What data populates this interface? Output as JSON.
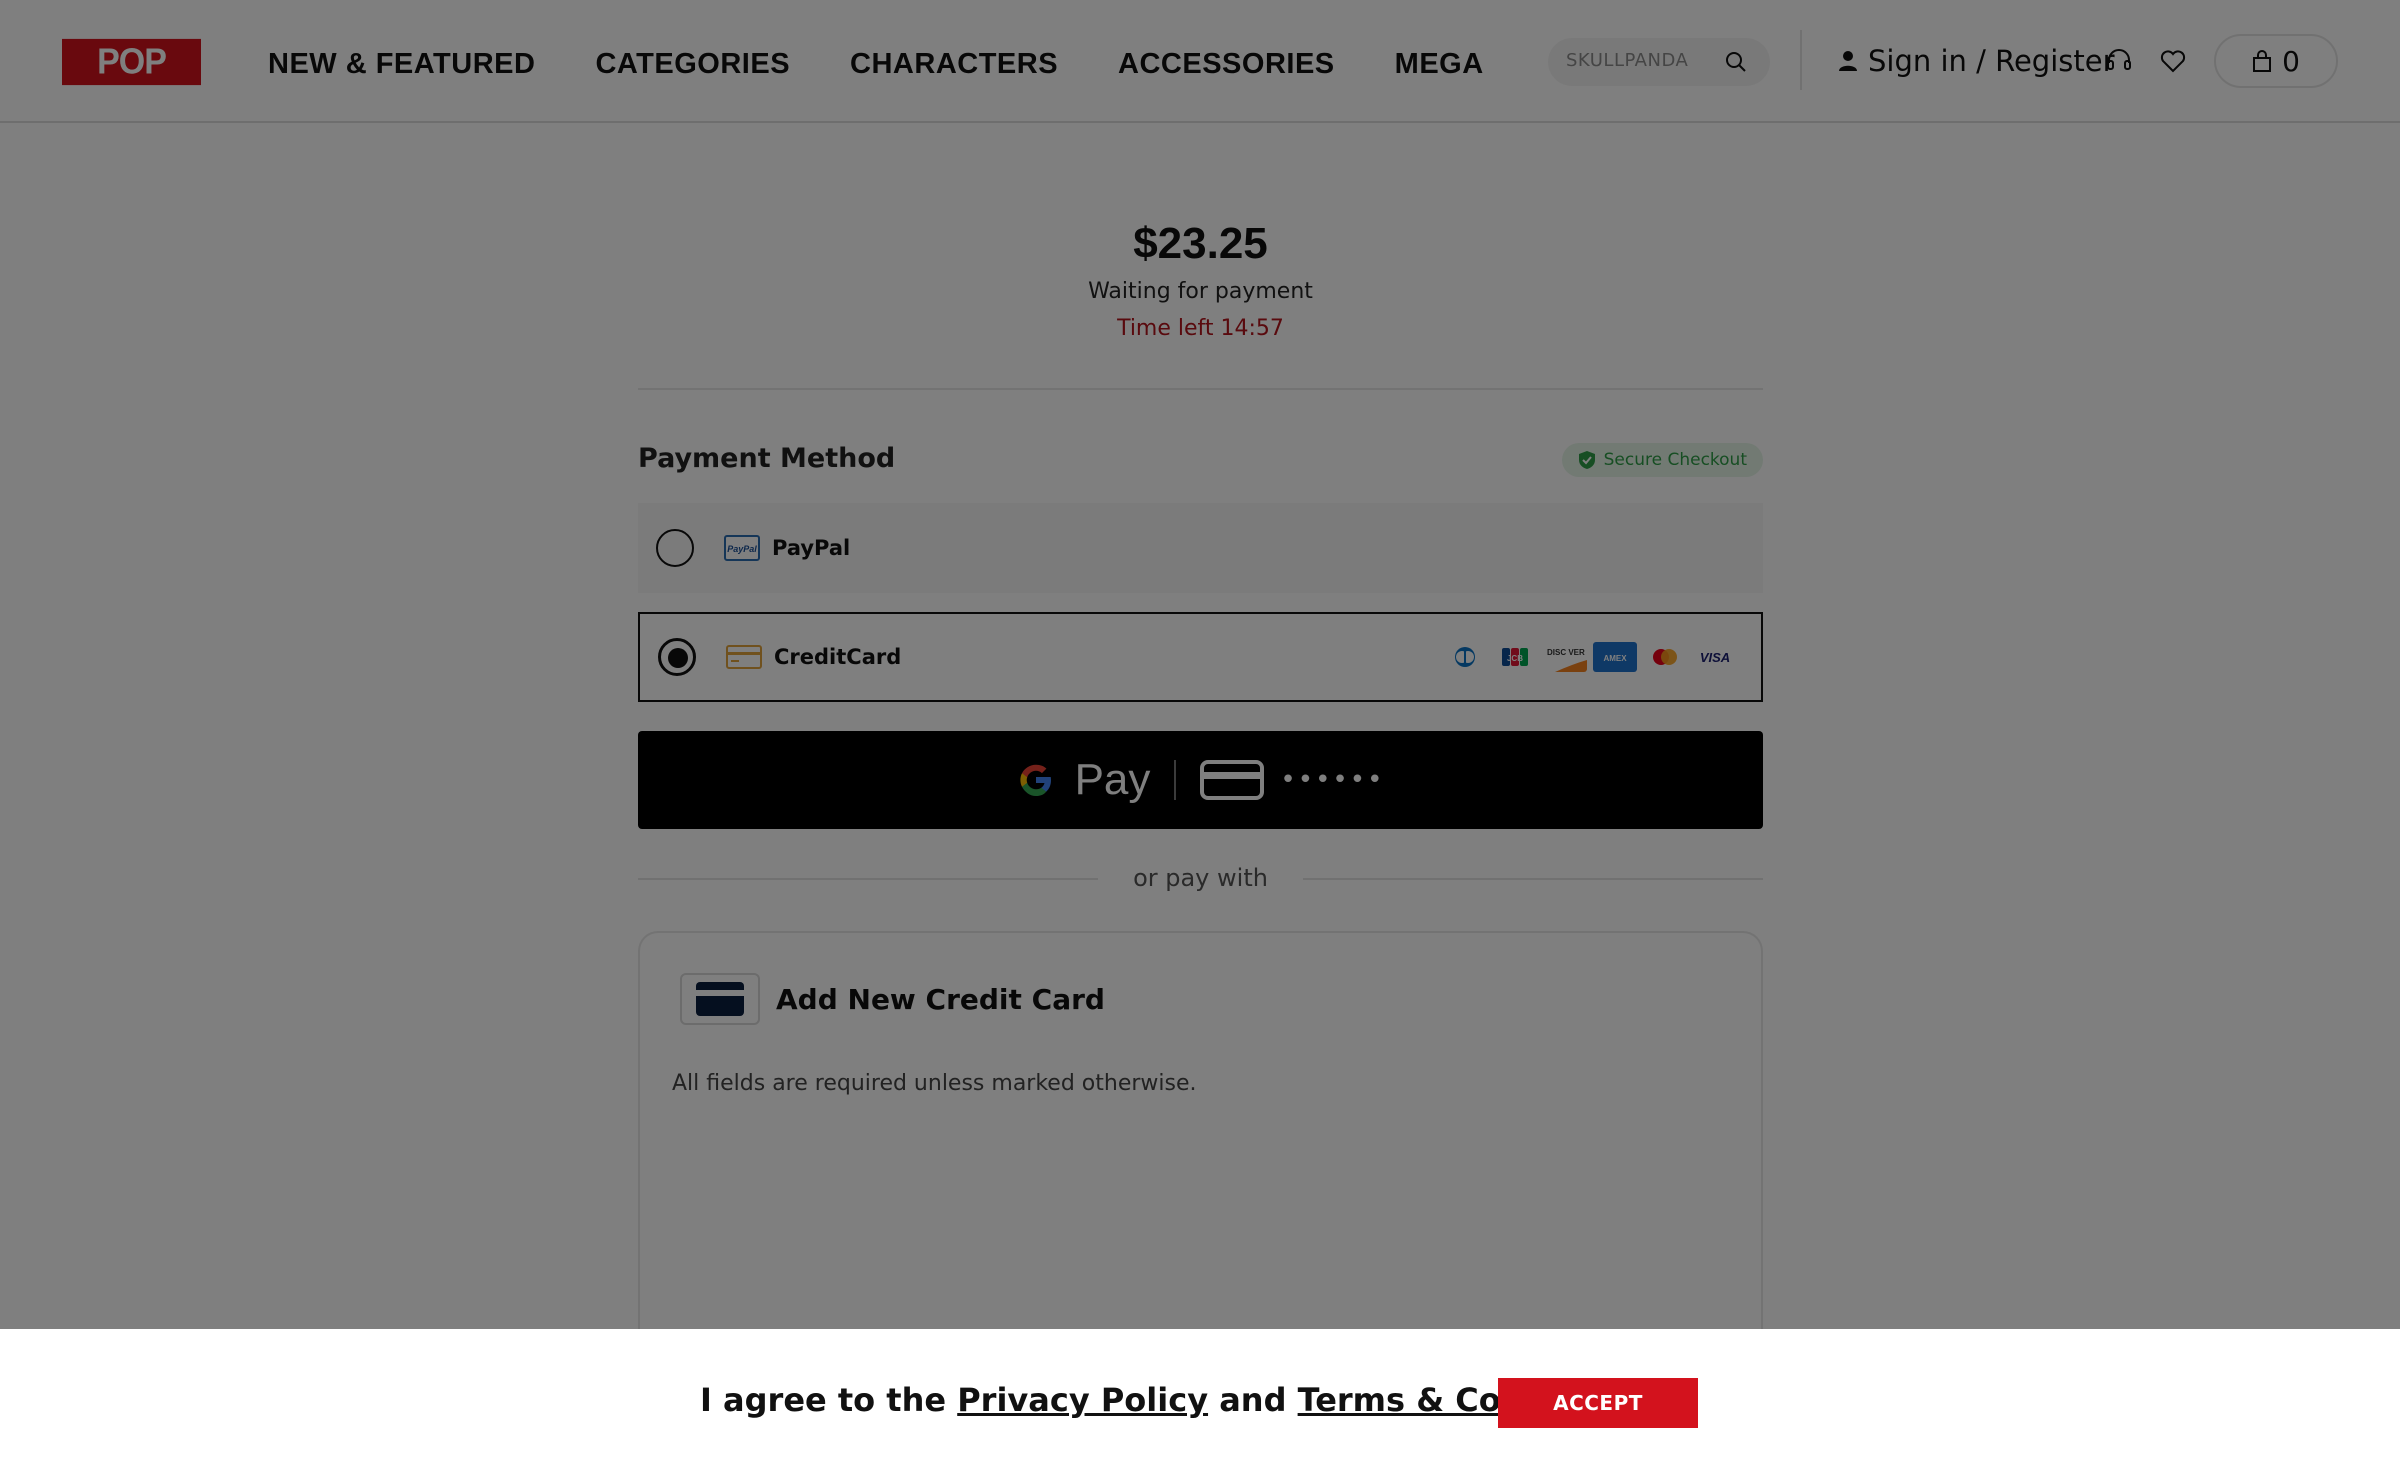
{
  "header": {
    "logo_text": "POP MART",
    "nav": [
      "NEW & FEATURED",
      "CATEGORIES",
      "CHARACTERS",
      "ACCESSORIES",
      "MEGA"
    ],
    "search_placeholder": "SKULLPANDA",
    "signin_label": "Sign in / Register",
    "cart_count": "0"
  },
  "order": {
    "amount": "$23.25",
    "status": "Waiting for payment",
    "time_left": "Time left 14:57"
  },
  "payment": {
    "title": "Payment Method",
    "secure_label": "Secure Checkout",
    "options": [
      {
        "label": "PayPal",
        "selected": false
      },
      {
        "label": "CreditCard",
        "selected": true
      }
    ],
    "card_brands": [
      "diners-club",
      "jcb",
      "discover",
      "american-express",
      "mastercard",
      "visa"
    ],
    "gpay_label": "Pay",
    "gpay_masked": "••••••",
    "or_pay_with": "or pay with",
    "add_card_title": "Add New Credit Card",
    "required_note": "All fields are required unless marked otherwise."
  },
  "consent": {
    "prefix": "I agree to the ",
    "privacy": "Privacy Policy",
    "and": " and ",
    "terms": "Terms & Conditions",
    "suffix": ".",
    "accept_label": "ACCEPT"
  },
  "colors": {
    "brand_red": "#d3121d",
    "secure_green": "#2f9d47",
    "timer_red": "#b3151d"
  }
}
